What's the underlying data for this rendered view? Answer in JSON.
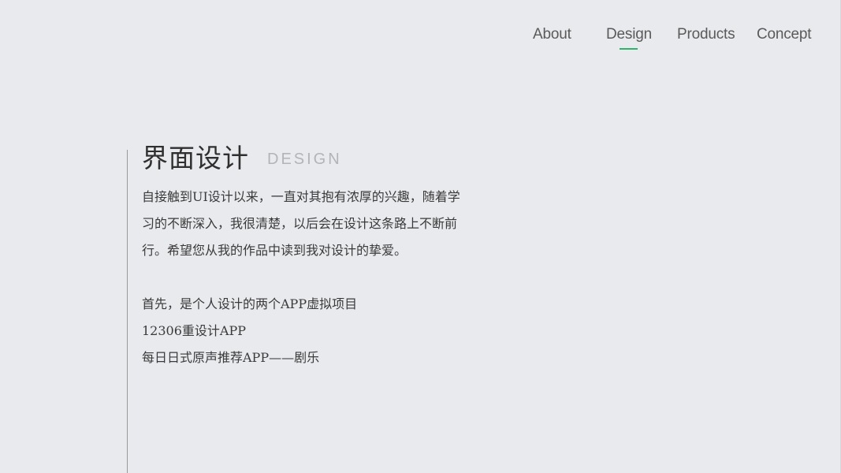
{
  "nav": {
    "items": [
      {
        "label": "About"
      },
      {
        "label": "Design",
        "active": true
      },
      {
        "label": "Products"
      },
      {
        "label": "Concept"
      }
    ],
    "accent_color": "#2db46a"
  },
  "section": {
    "title_cn": "界面设计",
    "title_en": "DESIGN",
    "intro_lines": [
      "自接触到UI设计以来，一直对其抱有浓厚的兴趣，随着学",
      "习的不断深入，我很清楚，以后会在设计这条路上不断前",
      "行。希望您从我的作品中读到我对设计的挚爱。"
    ],
    "list_lines": [
      "首先，是个人设计的两个APP虚拟项目",
      "12306重设计APP",
      "每日日式原声推荐APP——剧乐"
    ]
  }
}
